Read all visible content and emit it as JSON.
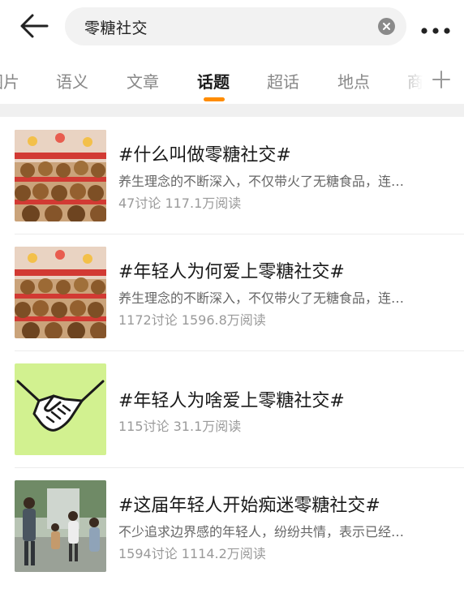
{
  "search": {
    "query": "零糖社交"
  },
  "icons": {
    "back": "arrow-left-icon",
    "clear": "close-circle-icon",
    "more": "more-horizontal-icon",
    "add": "plus-icon"
  },
  "tabs": [
    {
      "label": "图片"
    },
    {
      "label": "语义"
    },
    {
      "label": "文章"
    },
    {
      "label": "话题"
    },
    {
      "label": "超话"
    },
    {
      "label": "地点"
    },
    {
      "label": "商品"
    }
  ],
  "active_tab": "话题",
  "colors": {
    "accent": "#ff8c00",
    "title": "#1a1a1a",
    "muted": "#9a9a9a",
    "band": "#f0f0f0"
  },
  "topics": [
    {
      "title": "#什么叫做零糖社交#",
      "desc": "养生理念的不断深入，不仅带火了无糖食品，连…",
      "stats": "47讨论 117.1万阅读",
      "thumb": "plush-toys-photo"
    },
    {
      "title": "#年轻人为何爱上零糖社交#",
      "desc": "养生理念的不断深入，不仅带火了无糖食品，连…",
      "stats": "1172讨论 1596.8万阅读",
      "thumb": "plush-toys-photo"
    },
    {
      "title": "#年轻人为啥爱上零糖社交#",
      "desc": "",
      "stats": "115讨论 31.1万阅读",
      "thumb": "handshake-illustration"
    },
    {
      "title": "#这届年轻人开始痴迷零糖社交#",
      "desc": "不少追求边界感的年轻人，纷纷共情，表示已经…",
      "stats": "1594讨论 1114.2万阅读",
      "thumb": "people-photo"
    }
  ]
}
